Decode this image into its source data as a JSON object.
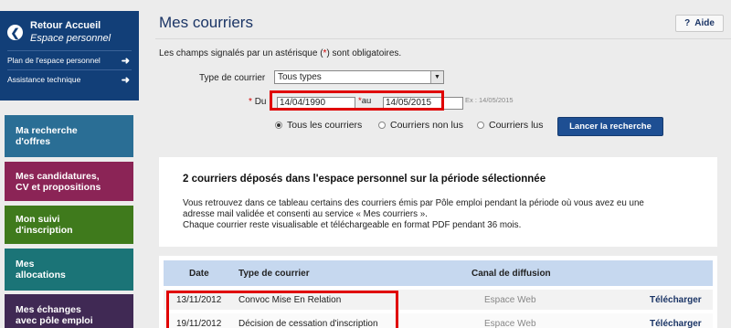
{
  "sidebar": {
    "home": {
      "title": "Retour Accueil",
      "subtitle": "Espace personnel"
    },
    "links": [
      {
        "label": "Plan de l'espace personnel"
      },
      {
        "label": "Assistance technique"
      }
    ],
    "menu": [
      {
        "line1": "Ma recherche",
        "line2": "d'offres",
        "color": "#2a6e95"
      },
      {
        "line1": "Mes candidatures,",
        "line2": "CV et propositions",
        "color": "#8b2456"
      },
      {
        "line1": "Mon suivi",
        "line2": "d'inscription",
        "color": "#3f7a1c"
      },
      {
        "line1": "Mes",
        "line2": "allocations",
        "color": "#1b7477"
      },
      {
        "line1": "Mes échanges",
        "line2": "avec pôle emploi",
        "color": "#402954"
      }
    ]
  },
  "header": {
    "title": "Mes courriers",
    "help_label": "Aide",
    "help_icon": "?"
  },
  "form": {
    "required_note_before": "Les champs signalés par un astérisque (",
    "required_star": "*",
    "required_note_after": ") sont obligatoires.",
    "type_label": "Type de courrier",
    "type_value": "Tous types",
    "du_label": "Du",
    "date_from": "14/04/1990",
    "au_label": "au",
    "date_to": "14/05/2015",
    "date_example": "Ex : 14/05/2015",
    "radios": [
      {
        "label": "Tous les courriers",
        "checked": true
      },
      {
        "label": "Courriers non lus",
        "checked": false
      },
      {
        "label": "Courriers lus",
        "checked": false
      }
    ],
    "search_button": "Lancer la recherche"
  },
  "info": {
    "title": "2 courriers déposés dans l'espace personnel sur la période sélectionnée",
    "line1": "Vous retrouvez dans ce tableau certains des courriers émis par Pôle emploi pendant la période où vous avez eu une",
    "line2": "adresse mail validée et consenti au service « Mes courriers ».",
    "line3": "Chaque courrier reste visualisable et téléchargeable en format PDF pendant 36 mois."
  },
  "table": {
    "headers": {
      "date": "Date",
      "type": "Type de courrier",
      "canal": "Canal de diffusion"
    },
    "rows": [
      {
        "date": "13/11/2012",
        "type": "Convoc Mise En Relation",
        "canal": "Espace Web",
        "action": "Télécharger"
      },
      {
        "date": "19/11/2012",
        "type": "Décision de cessation d'inscription",
        "canal": "Espace Web",
        "action": "Télécharger"
      }
    ]
  },
  "colors": {
    "nav_blue": "#123f78",
    "highlight_red": "#e00000",
    "table_header": "#c6d8ef"
  }
}
